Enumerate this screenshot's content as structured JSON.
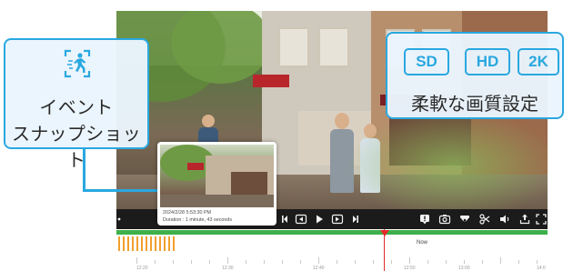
{
  "thumbnail": {
    "datetime": "2024/2/28 5:53:30 PM",
    "duration": "Duration : 1 minute, 43 seconds"
  },
  "event_callout": {
    "line1": "イベント",
    "line2": "スナップショット",
    "icon": "motion-person-icon"
  },
  "resolution_callout": {
    "options": [
      "SD",
      "HD",
      "2K"
    ],
    "caption": "柔軟な画質設定"
  },
  "timeline": {
    "now_label": "Now",
    "tick_labels": [
      "12:20",
      "12:30",
      "12:40",
      "12:50",
      "13:00",
      "14:0"
    ]
  },
  "controls": {
    "left_icons": [
      "more-icon",
      "skip-back-icon",
      "rewind-icon",
      "play-icon",
      "forward-icon",
      "skip-forward-icon"
    ],
    "right_icons": [
      "alert-icon",
      "snapshot-icon",
      "record-icon",
      "clip-icon",
      "volume-icon",
      "share-icon",
      "fullscreen-icon"
    ]
  },
  "colors": {
    "accent": "#29a8e0",
    "timeline_green": "#3eb049",
    "timeline_event": "#f29f2d",
    "timeline_cursor": "#e22b2b"
  }
}
